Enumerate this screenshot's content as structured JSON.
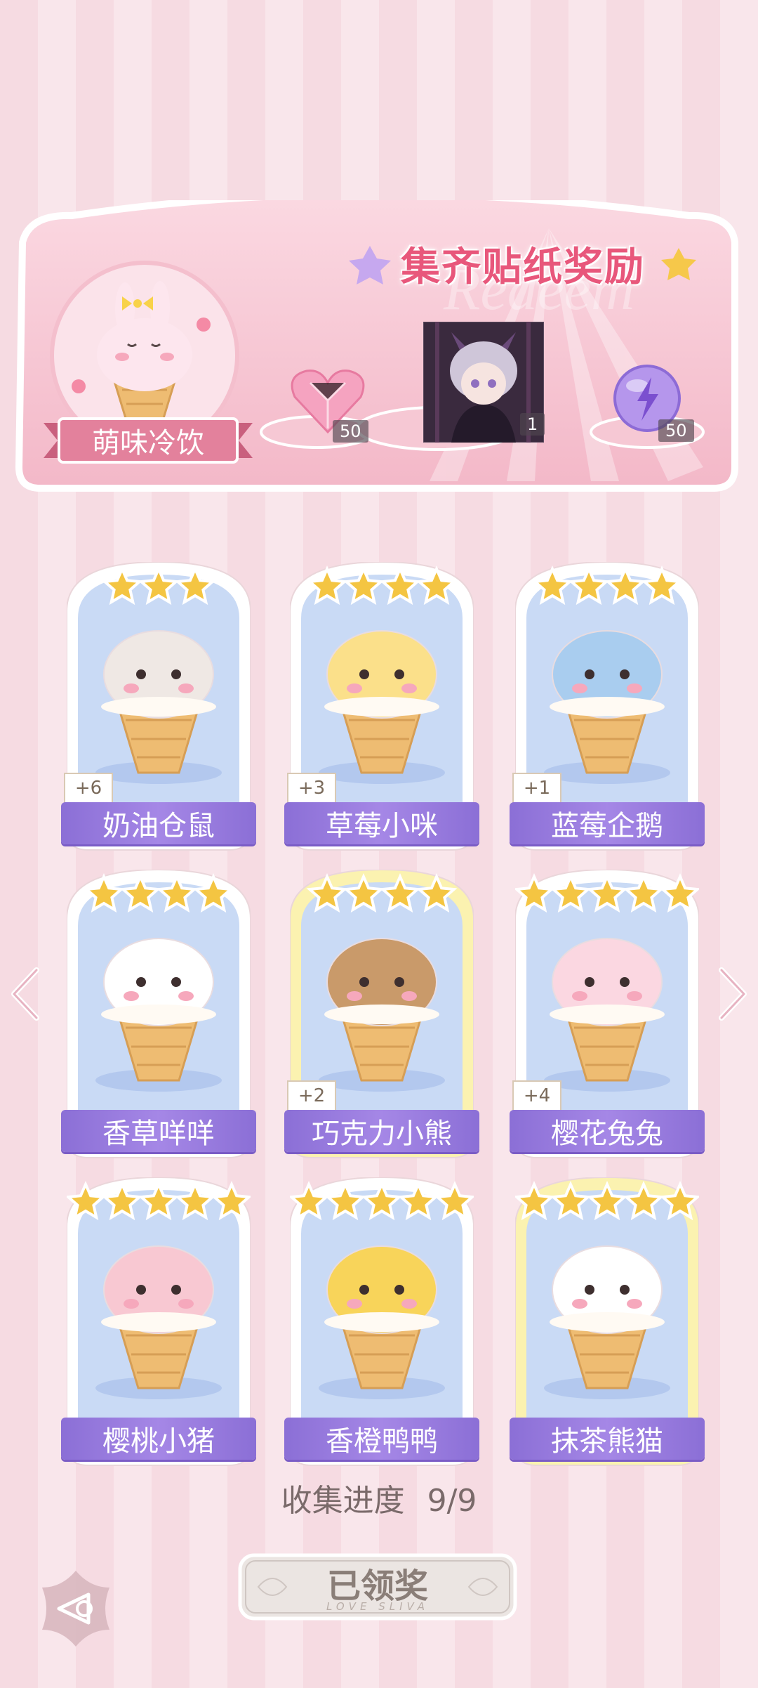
{
  "banner": {
    "title": "集齐贴纸奖励",
    "watermark": "Redeem",
    "series_name": "萌味冷饮",
    "rewards": [
      {
        "icon": "pink-heart-gem-icon",
        "count": "50"
      },
      {
        "icon": "character-portrait",
        "count": "1"
      },
      {
        "icon": "purple-lightning-orb-icon",
        "count": "50"
      }
    ]
  },
  "cards": [
    {
      "name": "奶油仓鼠",
      "stars": 3,
      "bonus": "+6",
      "icon": "hamster-ice-cream-icon",
      "golden": false
    },
    {
      "name": "草莓小咪",
      "stars": 4,
      "bonus": "+3",
      "icon": "cat-ice-cream-icon",
      "golden": false
    },
    {
      "name": "蓝莓企鹅",
      "stars": 4,
      "bonus": "+1",
      "icon": "penguin-ice-cream-icon",
      "golden": false
    },
    {
      "name": "香草咩咩",
      "stars": 4,
      "bonus": "",
      "icon": "sheep-ice-cream-icon",
      "golden": false
    },
    {
      "name": "巧克力小熊",
      "stars": 4,
      "bonus": "+2",
      "icon": "bear-ice-cream-icon",
      "golden": true
    },
    {
      "name": "樱花兔兔",
      "stars": 5,
      "bonus": "+4",
      "icon": "bunny-ice-cream-icon",
      "golden": false
    },
    {
      "name": "樱桃小猪",
      "stars": 5,
      "bonus": "",
      "icon": "pig-ice-cream-icon",
      "golden": false
    },
    {
      "name": "香橙鸭鸭",
      "stars": 5,
      "bonus": "",
      "icon": "duck-ice-cream-icon",
      "golden": false
    },
    {
      "name": "抹茶熊猫",
      "stars": 5,
      "bonus": "",
      "icon": "panda-ice-cream-icon",
      "golden": true
    }
  ],
  "progress": {
    "label": "收集进度",
    "value": "9/9"
  },
  "claim_button": {
    "label": "已领奖",
    "subtitle": "LOVE SLIVA"
  },
  "colors": {
    "accent_pink": "#e8577b",
    "label_purple": "#9a7ddf",
    "star_gold": "#f4c542"
  }
}
